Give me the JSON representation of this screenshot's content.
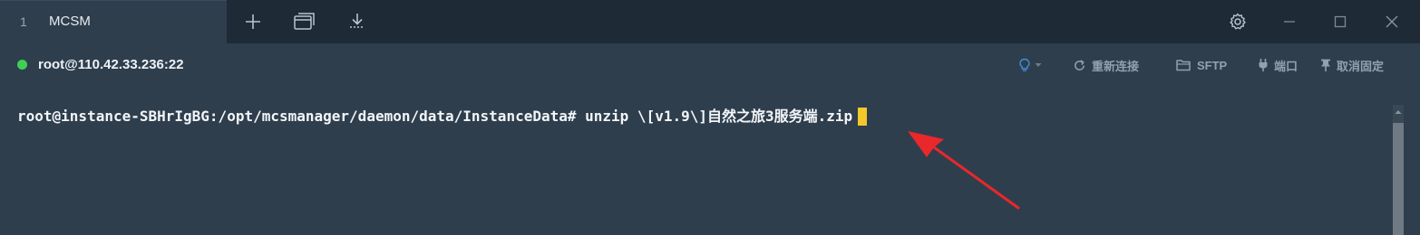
{
  "tab": {
    "index": "1",
    "title": "MCSM"
  },
  "toolbar": {
    "new_tab_icon": "plus-icon",
    "duplicate_icon": "windows-icon",
    "download_icon": "download-icon"
  },
  "window_controls": {
    "settings_icon": "gear-icon",
    "minimize_icon": "minimize-icon",
    "maximize_icon": "maximize-icon",
    "close_icon": "close-icon"
  },
  "session": {
    "host": "root@110.42.33.236:22",
    "status_color": "#3fcf55"
  },
  "actions": {
    "hint_icon": "lightbulb-icon",
    "reconnect": "重新连接",
    "sftp": "SFTP",
    "port": "端口",
    "unpin": "取消固定"
  },
  "terminal": {
    "line": "root@instance-SBHrIgBG:/opt/mcsmanager/daemon/data/InstanceData# unzip \\[v1.9\\]自然之旅3服务端.zip",
    "cursor_color": "#f2c82a"
  },
  "colors": {
    "background": "#2f3e4d",
    "tabbar": "#1e2a36",
    "annotation_arrow": "#e8282b"
  }
}
